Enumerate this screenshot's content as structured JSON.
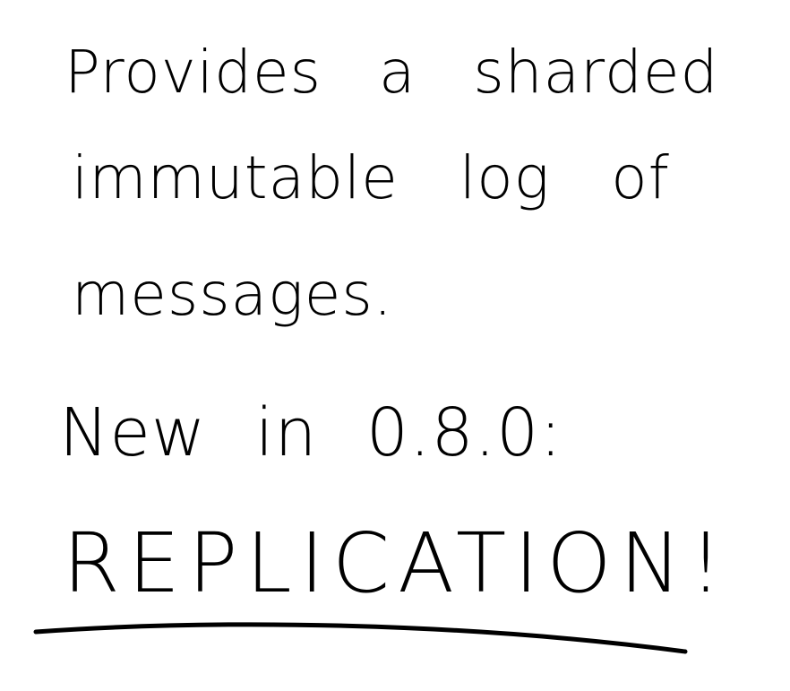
{
  "note": {
    "line1": "Provides a sharded",
    "line2": "immutable log of",
    "line3": "messages.",
    "line4": "New in 0.8.0:",
    "line5": "REPLICATION!"
  }
}
